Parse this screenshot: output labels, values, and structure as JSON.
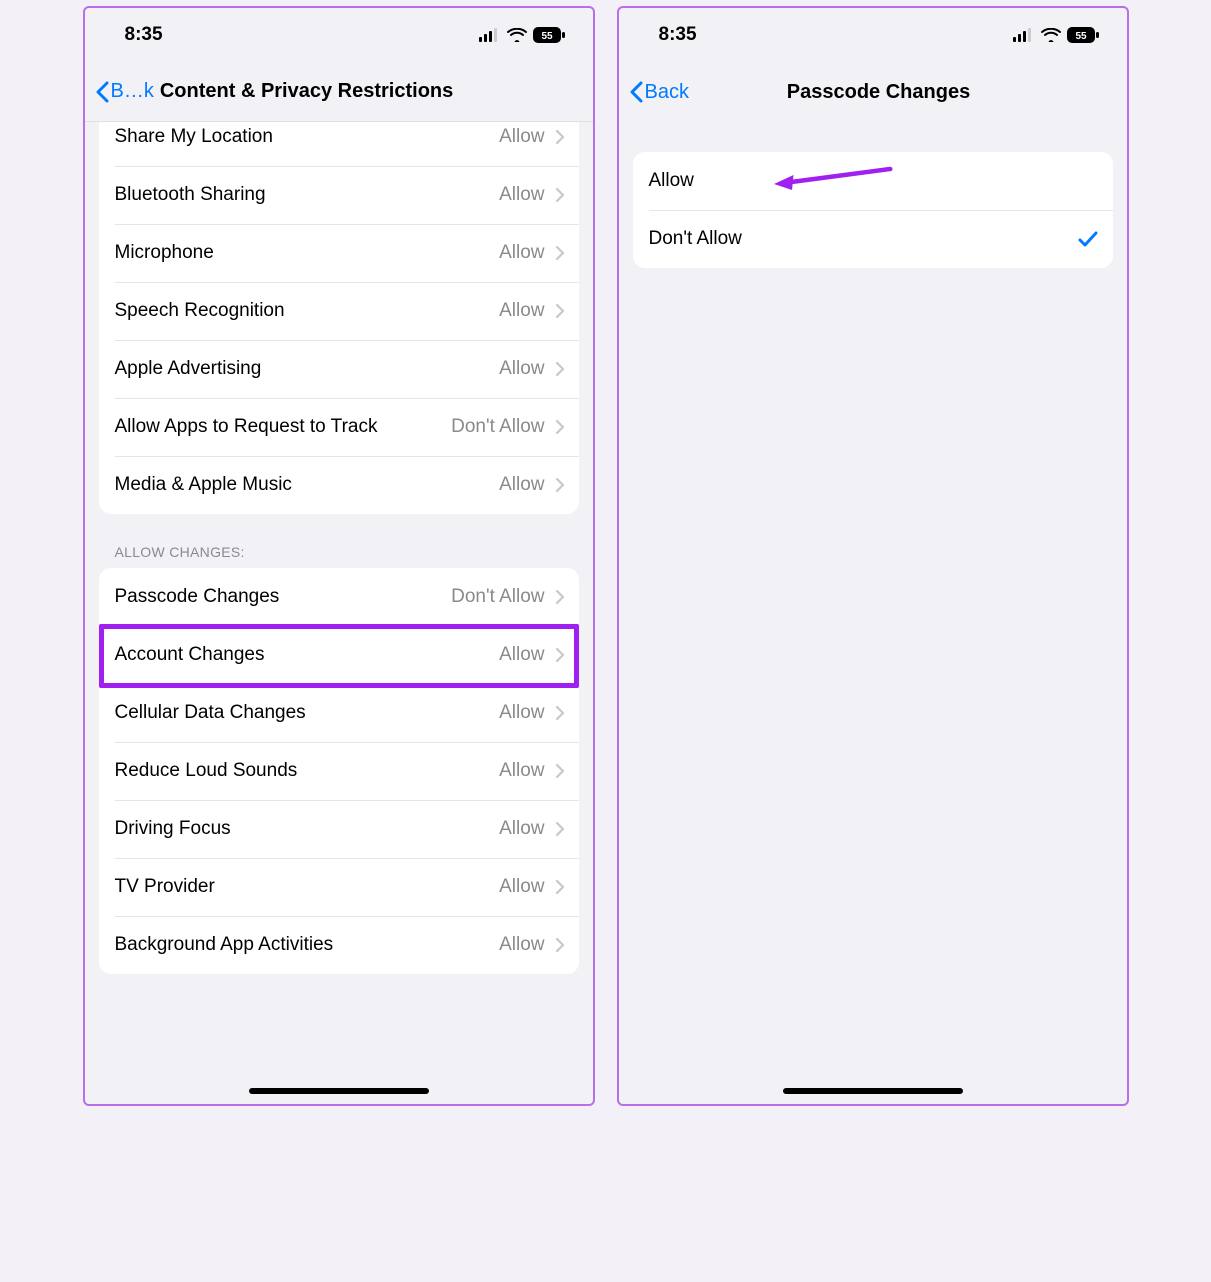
{
  "status": {
    "time": "8:35",
    "battery": "55"
  },
  "left": {
    "back_label": "B…k",
    "title": "Content & Privacy Restrictions",
    "group1": [
      {
        "label": "Share My Location",
        "value": "Allow"
      },
      {
        "label": "Bluetooth Sharing",
        "value": "Allow"
      },
      {
        "label": "Microphone",
        "value": "Allow"
      },
      {
        "label": "Speech Recognition",
        "value": "Allow"
      },
      {
        "label": "Apple Advertising",
        "value": "Allow"
      },
      {
        "label": "Allow Apps to Request to Track",
        "value": "Don't Allow"
      },
      {
        "label": "Media & Apple Music",
        "value": "Allow"
      }
    ],
    "group2_header": "Allow Changes:",
    "group2": [
      {
        "label": "Passcode Changes",
        "value": "Don't Allow"
      },
      {
        "label": "Account Changes",
        "value": "Allow"
      },
      {
        "label": "Cellular Data Changes",
        "value": "Allow"
      },
      {
        "label": "Reduce Loud Sounds",
        "value": "Allow"
      },
      {
        "label": "Driving Focus",
        "value": "Allow"
      },
      {
        "label": "TV Provider",
        "value": "Allow"
      },
      {
        "label": "Background App Activities",
        "value": "Allow"
      }
    ]
  },
  "right": {
    "back_label": "Back",
    "title": "Passcode Changes",
    "options": [
      {
        "label": "Allow",
        "selected": false
      },
      {
        "label": "Don't Allow",
        "selected": true
      }
    ]
  }
}
